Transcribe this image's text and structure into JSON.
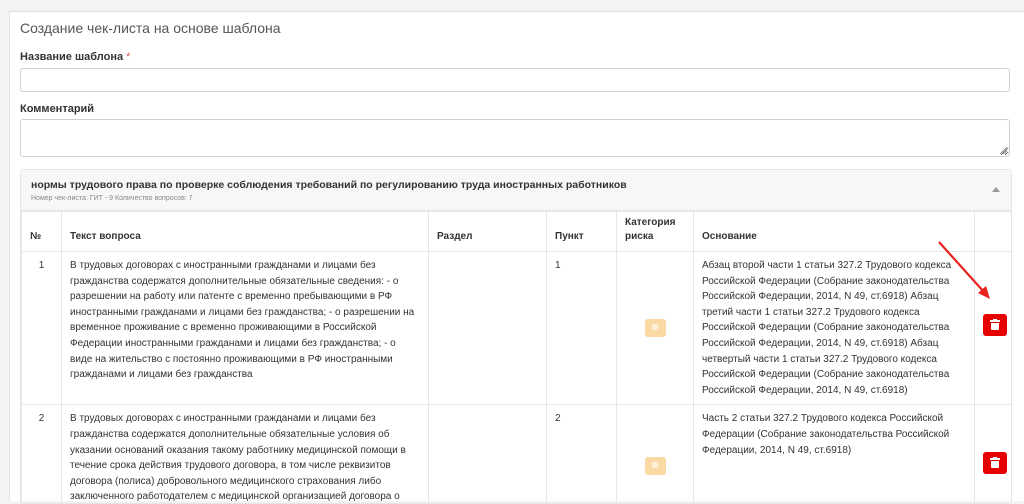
{
  "page": {
    "title": "Создание чек-листа на основе шаблона"
  },
  "form": {
    "template_name_label": "Название шаблона",
    "required_mark": "*",
    "template_name_value": "",
    "comment_label": "Комментарий",
    "comment_value": ""
  },
  "panel": {
    "title": "нормы трудового права по проверке соблюдения требований по регулированию труда иностранных работников",
    "subtitle": "Номер чек-листа: ГИТ - 9 Количество вопросов: 7"
  },
  "table": {
    "headers": {
      "num": "№",
      "question": "Текст вопроса",
      "section": "Раздел",
      "point": "Пункт",
      "risk": "Категория риска",
      "basis": "Основание"
    },
    "rows": [
      {
        "num": "1",
        "question": "В трудовых договорах с иностранными гражданами и лицами без гражданства содержатся дополнительные обязательные сведения: - о разрешении на работу или патенте с временно пребывающими в РФ иностранными гражданами и лицами без гражданства; - о разрешении на временное проживание с временно проживающими в Российской Федерации иностранными гражданами и лицами без гражданства; - о виде на жительство с постоянно проживающими в РФ иностранными гражданами и лицами без гражданства",
        "section": "",
        "point": "1",
        "risk": "III",
        "basis": "Абзац второй части 1 статьи 327.2 Трудового кодекса Российской Федерации (Собрание законодательства Российской Федерации, 2014, N 49, ст.6918) Абзац третий части 1 статьи 327.2 Трудового кодекса Российской Федерации (Собрание законодательства Российской Федерации, 2014, N 49, ст.6918) Абзац четвертый части 1 статьи 327.2 Трудового кодекса Российской Федерации (Собрание законодательства Российской Федерации, 2014, N 49, ст.6918)"
      },
      {
        "num": "2",
        "question": "В трудовых договорах с иностранными гражданами и лицами без гражданства содержатся дополнительные обязательные условия об указании оснований оказания такому работнику медицинской помощи в течение срока действия трудового договора, в том числе реквизитов договора (полиса) добровольного медицинского страхования либо заключенного работодателем с медицинской организацией договора о предоставлении такому работнику платных медицинских услуг",
        "section": "",
        "point": "2",
        "risk": "III",
        "basis": "Часть 2 статьи 327.2 Трудового кодекса Российской Федерации (Собрание законодательства Российской Федерации, 2014, N 49, ст.6918)"
      }
    ]
  },
  "colors": {
    "delete": "#e60000",
    "risk_badge": "#fbd9a4",
    "arrow": "#e8231d"
  },
  "icons": {
    "delete": "trash-icon",
    "collapse": "chevron-up-icon"
  }
}
